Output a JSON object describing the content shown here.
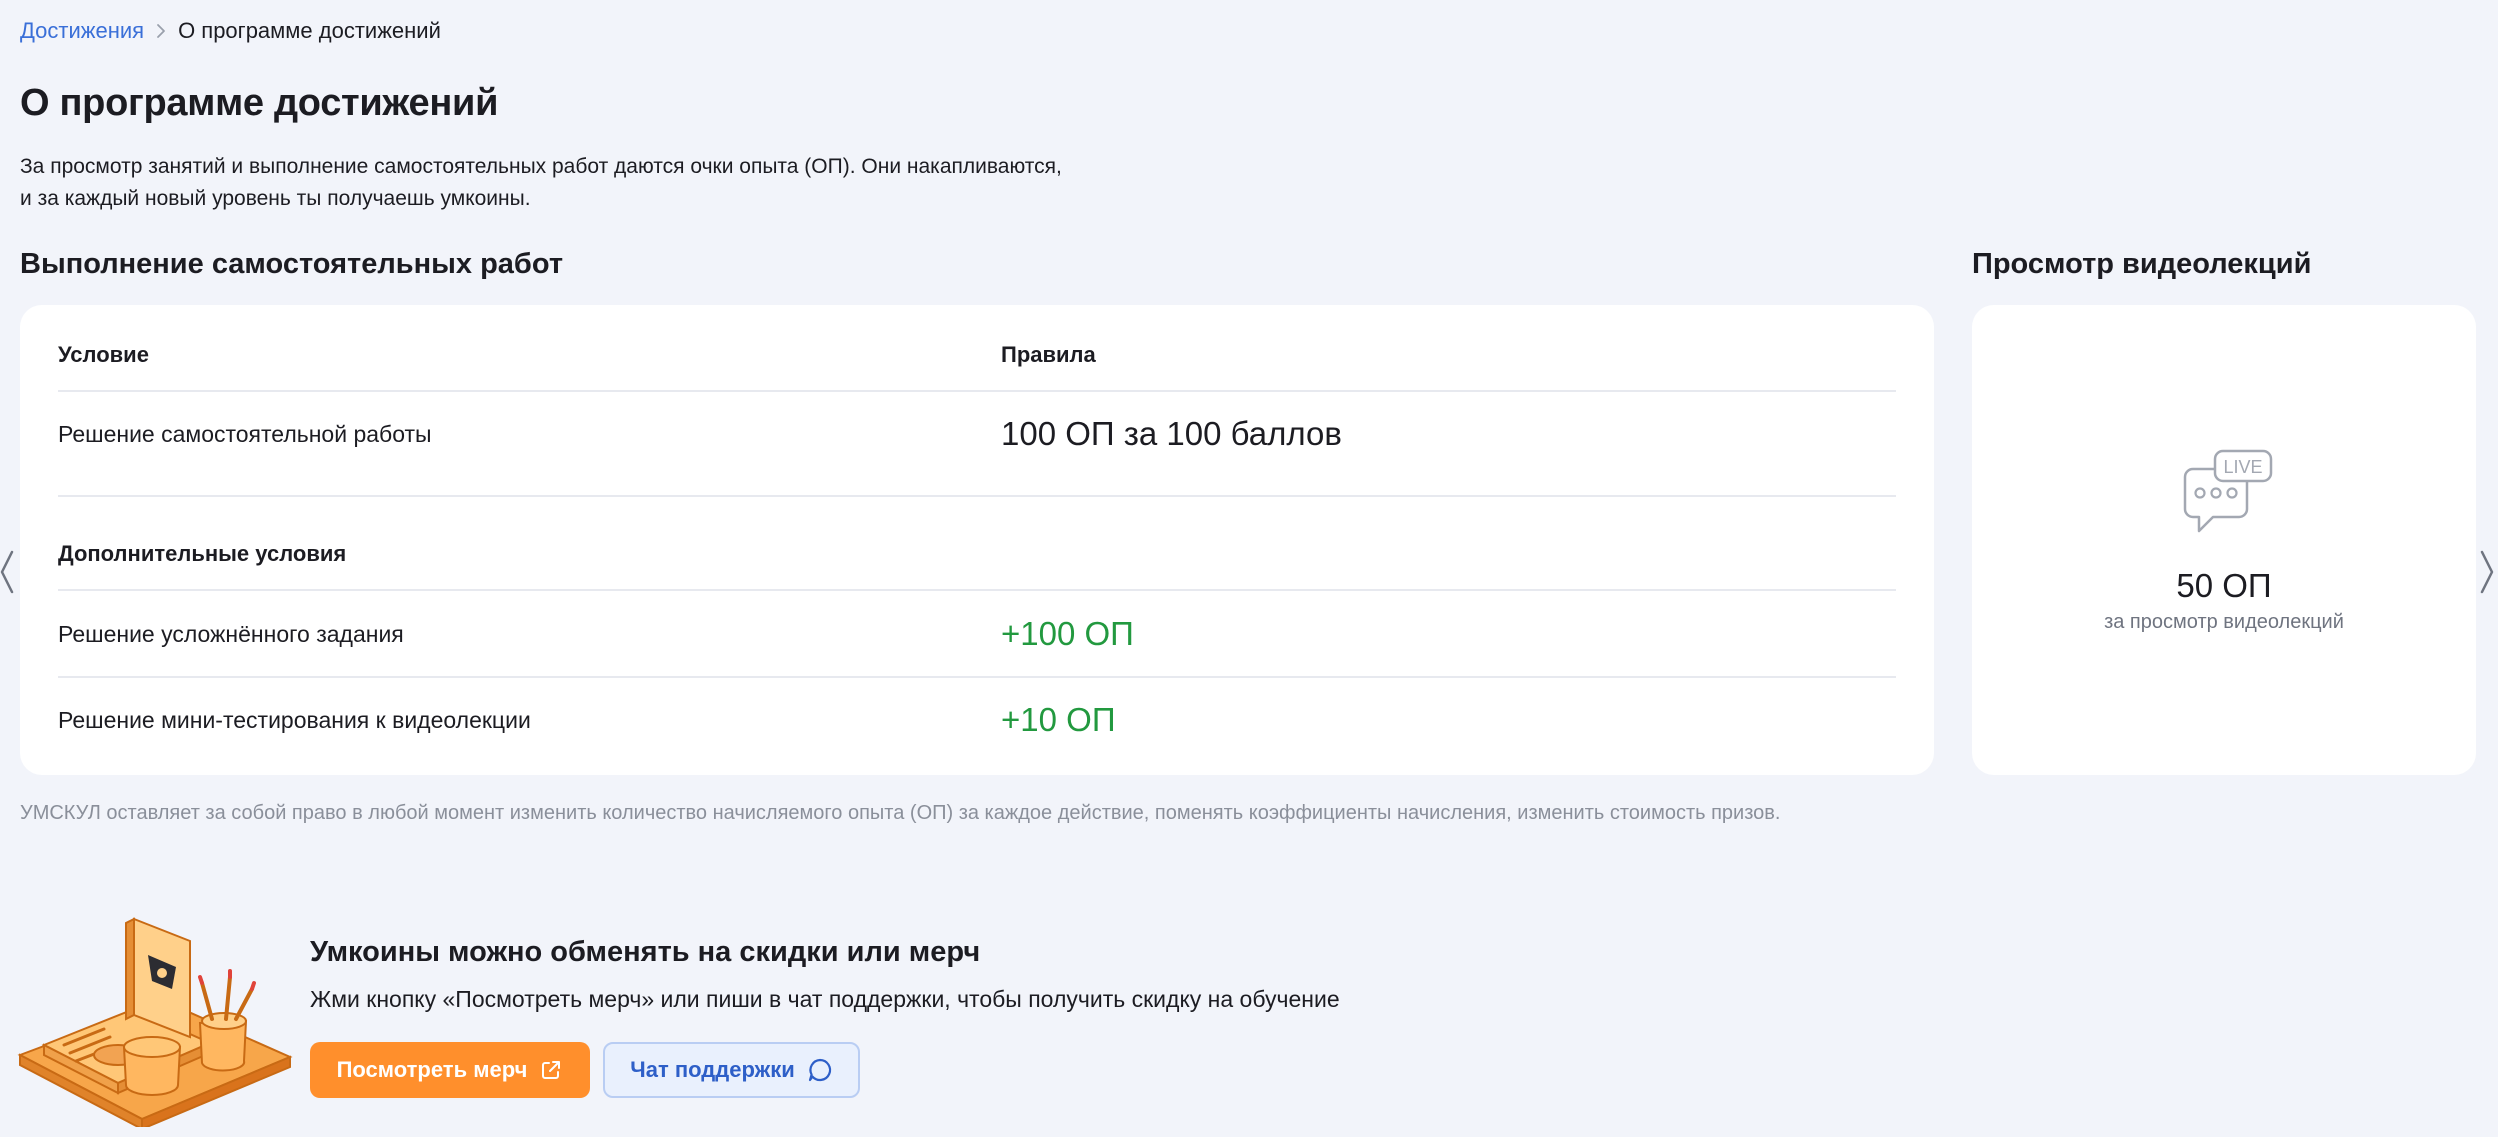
{
  "breadcrumb": {
    "parent": "Достижения",
    "current": "О программе достижений"
  },
  "page_title": "О программе достижений",
  "intro": {
    "line1": "За просмотр занятий и выполнение самостоятельных работ даются очки опыта (ОП). Они накапливаются,",
    "line2": "и за каждый новый уровень ты получаешь умкоины."
  },
  "works_section": {
    "title": "Выполнение самостоятельных работ",
    "headers": {
      "condition": "Условие",
      "rules": "Правила"
    },
    "main_row": {
      "condition": "Решение самостоятельной работы",
      "rule": "100 ОП за 100 баллов"
    },
    "extra_title": "Дополнительные условия",
    "extra_rows": [
      {
        "condition": "Решение усложнённого задания",
        "rule": "+100 ОП"
      },
      {
        "condition": "Решение мини-тестирования к видеолекции",
        "rule": "+10 ОП"
      }
    ]
  },
  "video_section": {
    "title": "Просмотр видеолекций",
    "icon": "live-chat-icon",
    "icon_text": "LIVE",
    "value": "50 ОП",
    "caption": "за просмотр видеолекций"
  },
  "disclaimer": "УМСКУЛ оставляет за собой право в любой момент изменить количество начисляемого опыта (ОП) за каждое действие, поменять коэффициенты начисления, изменить стоимость призов.",
  "promo": {
    "title": "Умкоины можно обменять на скидки или мерч",
    "text": "Жми кнопку «Посмотреть мерч» или пиши в чат поддержки, чтобы получить скидку на обучение",
    "merch_button": "Посмотреть мерч",
    "support_button": "Чат поддержки"
  },
  "colors": {
    "background": "#f2f4fa",
    "link": "#3a6fd8",
    "green": "#22993f",
    "orange": "#ff8f2c",
    "secondary_button_bg": "#e9f0fd"
  }
}
